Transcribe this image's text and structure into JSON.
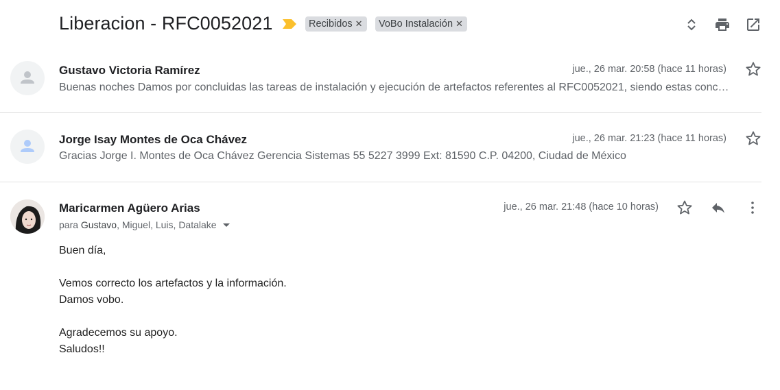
{
  "thread": {
    "subject": "Liberacion - RFC0052021",
    "labels": [
      {
        "name": "Recibidos"
      },
      {
        "name": "VoBo Instalación"
      }
    ]
  },
  "icons": {
    "importance": "importance-marker-icon",
    "expand": "expand-all-icon",
    "print": "print-icon",
    "open_new_window": "open-in-new-window-icon",
    "star": "star-icon",
    "reply": "reply-icon",
    "more": "more-vert-icon",
    "dropdown": "dropdown-arrow-icon",
    "label_close": "close-icon"
  },
  "colors": {
    "importance": "#fbc02d",
    "chip_bg": "#dadce0",
    "avatar_default": "#c0c4c9",
    "avatar_blue": "#aecbfa"
  },
  "messages": [
    {
      "sender": "Gustavo Victoria Ramírez",
      "date": "jue., 26 mar. 20:58 (hace 11 horas)",
      "snippet": "Buenas noches Damos por concluidas las tareas de instalación y ejecución de artefactos referentes al RFC0052021, siendo estas conc…"
    },
    {
      "sender": "Jorge Isay Montes de Oca Chávez",
      "date": "jue., 26 mar. 21:23 (hace 11 horas)",
      "snippet": "Gracias Jorge I. Montes de Oca Chávez Gerencia Sistemas 55 5227 3999 Ext: 81590 C.P. 04200, Ciudad de México"
    },
    {
      "sender": "Maricarmen Agüero Arias",
      "date": "jue., 26 mar. 21:48 (hace 10 horas)",
      "to_prefix": "para",
      "to_first": "Gustavo",
      "to_rest": ", Miguel, Luis, Datalake",
      "body": {
        "line1": "Buen día,",
        "line2": "Vemos correcto los artefactos y la información.",
        "line3": "Damos vobo.",
        "line4": "Agradecemos su apoyo.",
        "line5": "Saludos!!"
      }
    }
  ]
}
